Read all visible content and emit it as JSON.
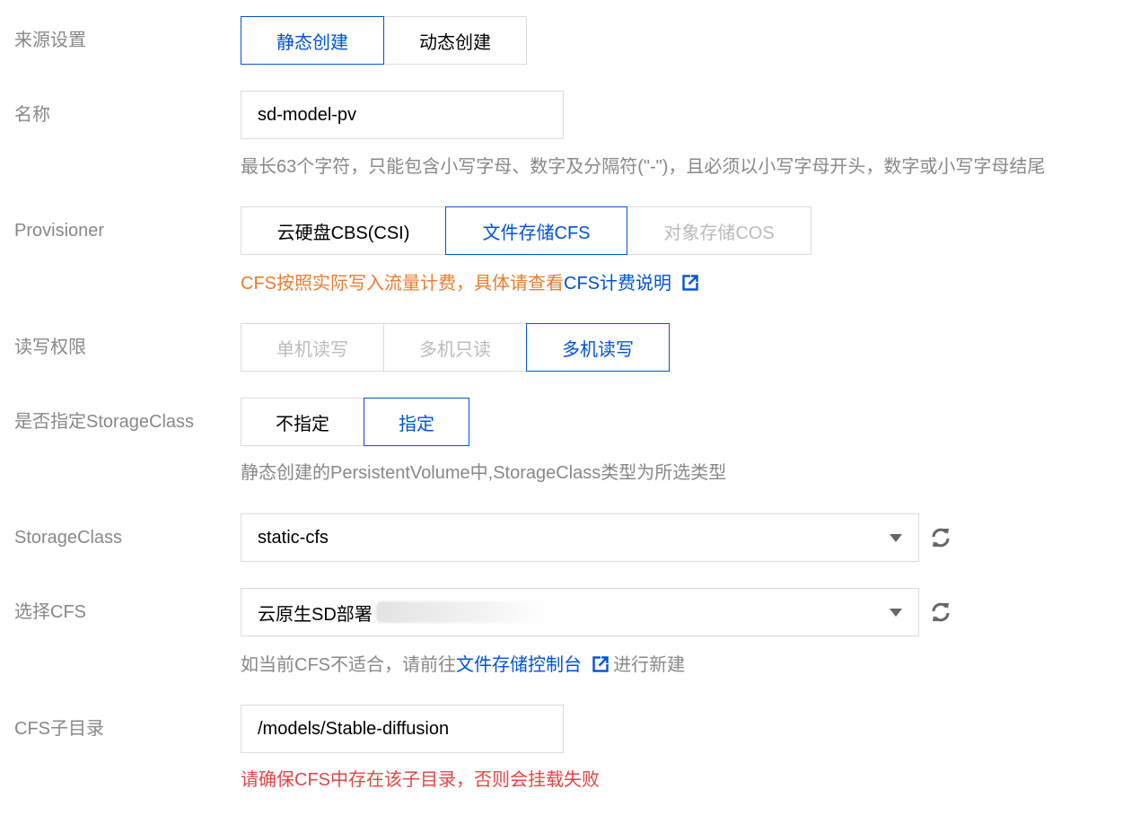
{
  "source": {
    "label": "来源设置",
    "options": [
      "静态创建",
      "动态创建"
    ]
  },
  "name": {
    "label": "名称",
    "value": "sd-model-pv",
    "hint": "最长63个字符，只能包含小写字母、数字及分隔符(\"-\")，且必须以小写字母开头，数字或小写字母结尾"
  },
  "provisioner": {
    "label": "Provisioner",
    "options": [
      "云硬盘CBS(CSI)",
      "文件存储CFS",
      "对象存储COS"
    ],
    "note_text": "CFS按照实际写入流量计费，具体请查看",
    "note_link": "CFS计费说明"
  },
  "access": {
    "label": "读写权限",
    "options": [
      "单机读写",
      "多机只读",
      "多机读写"
    ]
  },
  "specify_sc": {
    "label": "是否指定StorageClass",
    "options": [
      "不指定",
      "指定"
    ],
    "hint": "静态创建的PersistentVolume中,StorageClass类型为所选类型"
  },
  "storage_class": {
    "label": "StorageClass",
    "value": "static-cfs"
  },
  "cfs": {
    "label": "选择CFS",
    "value": "云原生SD部署",
    "hint_pre": "如当前CFS不适合，请前往",
    "hint_link": "文件存储控制台",
    "hint_post": "进行新建"
  },
  "subdir": {
    "label": "CFS子目录",
    "value": "/models/Stable-diffusion",
    "warning": "请确保CFS中存在该子目录，否则会挂载失败"
  },
  "colors": {
    "accent": "#0052d9",
    "warning_orange": "#ed7b2f",
    "error_red": "#e54545",
    "label_gray": "#888888",
    "border": "#dcdcdc"
  },
  "icons": [
    "external-link-icon",
    "refresh-icon",
    "dropdown-caret-icon"
  ]
}
